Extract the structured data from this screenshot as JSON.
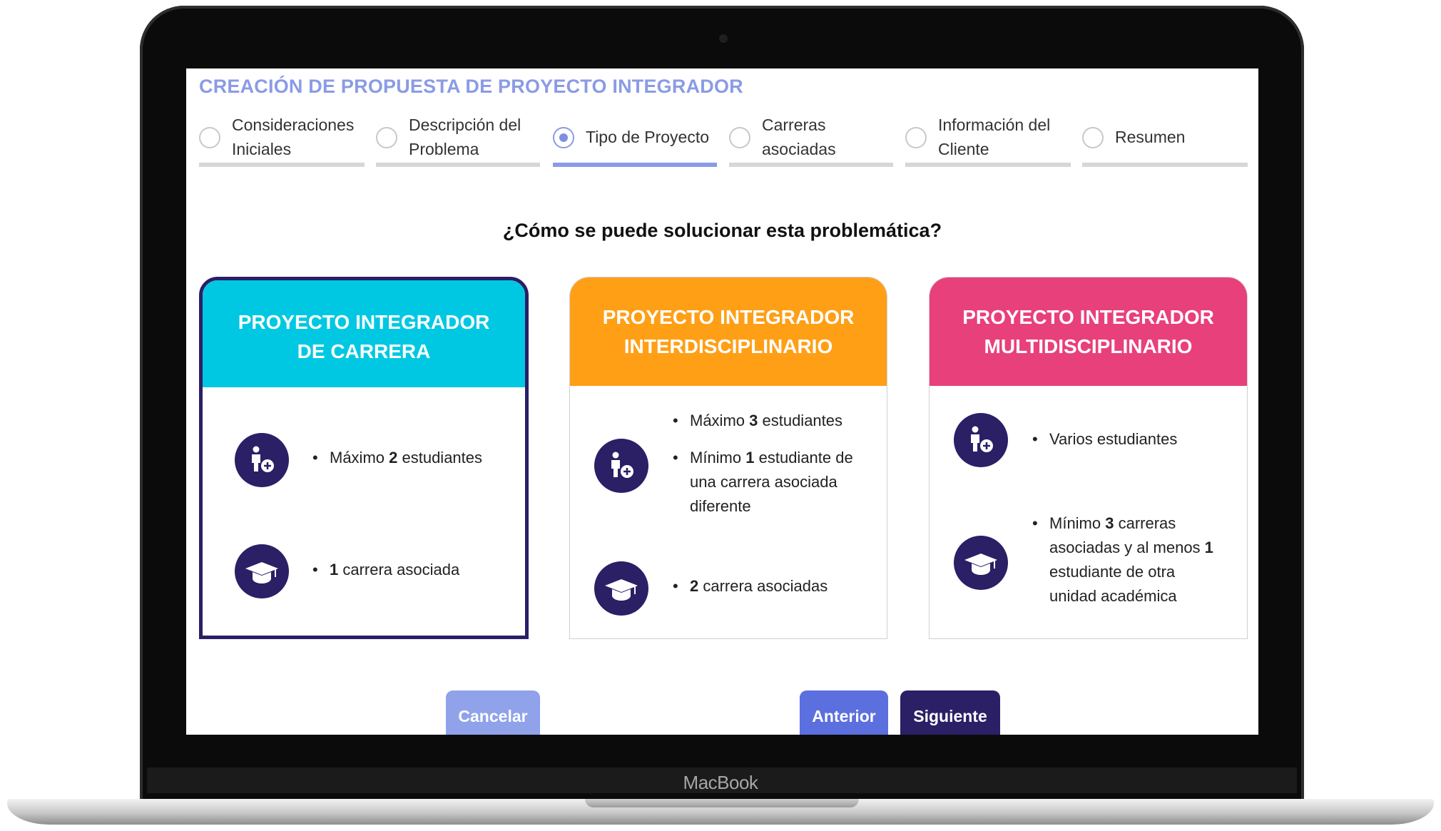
{
  "device": {
    "brand": "MacBook"
  },
  "page": {
    "title": "CREACIÓN DE PROPUESTA DE PROYECTO INTEGRADOR"
  },
  "steps": [
    {
      "line1": "Consideraciones",
      "line2": "Iniciales"
    },
    {
      "line1": "Descripción del",
      "line2": "Problema"
    },
    {
      "line1": "Tipo de Proyecto",
      "line2": ""
    },
    {
      "line1": "Carreras",
      "line2": "asociadas"
    },
    {
      "line1": "Información del",
      "line2": "Cliente"
    },
    {
      "line1": "Resumen",
      "line2": ""
    }
  ],
  "active_step": 2,
  "question": "¿Cómo se puede solucionar esta problemática?",
  "cards": [
    {
      "color": "#00c8e2",
      "title": "PROYECTO INTEGRADOR DE CARRERA",
      "selected": true,
      "students": {
        "pre": "Máximo ",
        "bold": "2",
        "post": " estudiantes"
      },
      "careers": {
        "pre": "",
        "bold": "1",
        "post": " carrera asociada"
      }
    },
    {
      "color": "#ff9f16",
      "title": "PROYECTO INTEGRADOR INTERDISCIPLINARIO",
      "selected": false,
      "students_a": {
        "pre": "Máximo ",
        "bold": "3",
        "post": " estudiantes"
      },
      "students_b": {
        "pre": "Mínimo ",
        "bold": "1",
        "post": " estudiante de una carrera asociada diferente"
      },
      "careers": {
        "pre": "",
        "bold": "2",
        "post": " carrera asociadas"
      }
    },
    {
      "color": "#e8407a",
      "title": "PROYECTO INTEGRADOR MULTIDISCIPLINARIO",
      "selected": false,
      "students": {
        "pre": "Varios estudiantes",
        "bold": "",
        "post": ""
      },
      "careers": {
        "pre": "Mínimo ",
        "bold": "3",
        "mid": " carreras asociadas y al menos ",
        "bold2": "1",
        "post": " estudiante de otra unidad académica"
      }
    }
  ],
  "icons": {
    "student": "person-add-icon",
    "career": "graduation-cap-icon"
  },
  "colors": {
    "accent": "#8a9be6",
    "dark": "#2b1f66",
    "cancel": "#8fa2ea",
    "previous": "#5b6fde"
  },
  "buttons": {
    "cancel": "Cancelar",
    "previous": "Anterior",
    "next": "Siguiente"
  }
}
